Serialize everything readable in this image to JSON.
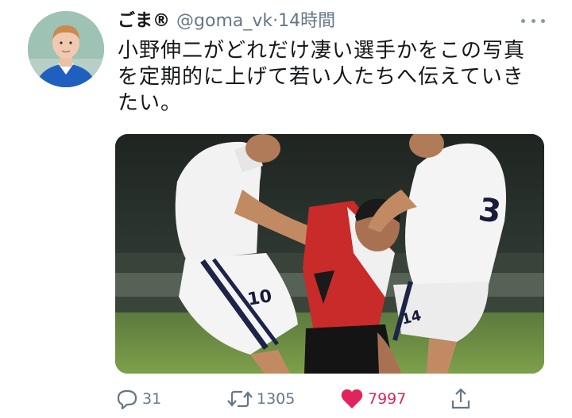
{
  "tweet": {
    "display_name": "ごま®",
    "handle": "@goma_vk",
    "separator": "·",
    "time": "14時間",
    "text": "小野伸二がどれだけ凄い選手かをこの写真を定期的に上げて若い人たちへ伝えていきたい。",
    "avatar_icon": "user-avatar-photo",
    "more_icon": "more-options-icon",
    "media_description_icon": "soccer-photo",
    "jersey_numbers": [
      "10",
      "14"
    ]
  },
  "actions": {
    "reply_count": "31",
    "retweet_count": "1305",
    "like_count": "7997",
    "reply_icon": "reply-icon",
    "retweet_icon": "retweet-icon",
    "like_icon": "heart-icon",
    "share_icon": "share-icon"
  },
  "colors": {
    "text": "#14171a",
    "secondary": "#657786",
    "like": "#e0245e",
    "background": "#ffffff"
  }
}
